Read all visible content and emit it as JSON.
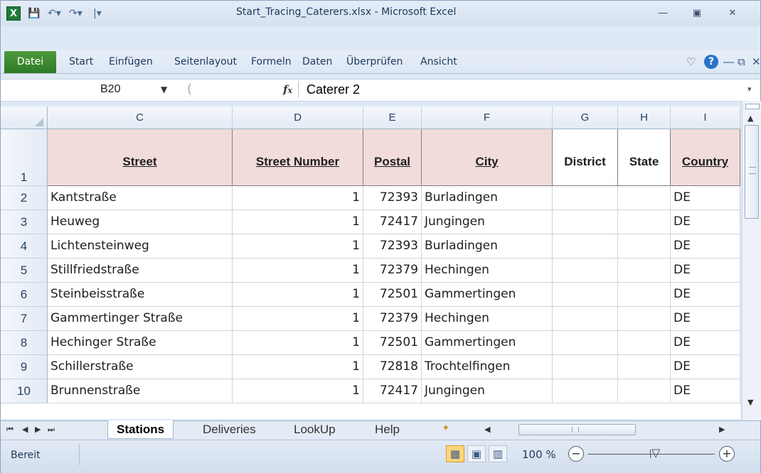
{
  "window": {
    "title": "Start_Tracing_Caterers.xlsx  -  Microsoft Excel",
    "app_icon": "excel-icon",
    "minimize_icon": "minimize-icon",
    "restore_icon": "restore-icon",
    "close_icon": "close-icon"
  },
  "qat": {
    "save_icon": "save-icon",
    "undo_icon": "undo-icon",
    "redo_icon": "redo-icon",
    "customize_icon": "customize-qat-icon"
  },
  "ribbon": {
    "file_tab": "Datei",
    "tabs": [
      "Start",
      "Einfügen",
      "Seitenlayout",
      "Formeln",
      "Daten",
      "Überprüfen",
      "Ansicht"
    ]
  },
  "formula_bar": {
    "name_box": "B20",
    "fx_label": "fx",
    "content": "Caterer 2"
  },
  "grid": {
    "columns": [
      "C",
      "D",
      "E",
      "F",
      "G",
      "H",
      "I"
    ],
    "header_row": {
      "row_number": "1",
      "cells": [
        "Street",
        "Street Number",
        "Postal",
        "City",
        "District",
        "State",
        "Country"
      ]
    },
    "rows": [
      {
        "n": "2",
        "street": "Kantstraße",
        "number": "1",
        "postal": "72393",
        "city": "Burladingen",
        "district": "",
        "state": "",
        "country": "DE"
      },
      {
        "n": "3",
        "street": "Heuweg",
        "number": "1",
        "postal": "72417",
        "city": "Jungingen",
        "district": "",
        "state": "",
        "country": "DE"
      },
      {
        "n": "4",
        "street": "Lichtensteinweg",
        "number": "1",
        "postal": "72393",
        "city": "Burladingen",
        "district": "",
        "state": "",
        "country": "DE"
      },
      {
        "n": "5",
        "street": "Stillfriedstraße",
        "number": "1",
        "postal": "72379",
        "city": "Hechingen",
        "district": "",
        "state": "",
        "country": "DE"
      },
      {
        "n": "6",
        "street": "Steinbeisstraße",
        "number": "1",
        "postal": "72501",
        "city": "Gammertingen",
        "district": "",
        "state": "",
        "country": "DE"
      },
      {
        "n": "7",
        "street": "Gammertinger Straße",
        "number": "1",
        "postal": "72379",
        "city": "Hechingen",
        "district": "",
        "state": "",
        "country": "DE"
      },
      {
        "n": "8",
        "street": "Hechinger Straße",
        "number": "1",
        "postal": "72501",
        "city": "Gammertingen",
        "district": "",
        "state": "",
        "country": "DE"
      },
      {
        "n": "9",
        "street": "Schillerstraße",
        "number": "1",
        "postal": "72818",
        "city": "Trochtelfingen",
        "district": "",
        "state": "",
        "country": "DE"
      },
      {
        "n": "10",
        "street": "Brunnenstraße",
        "number": "1",
        "postal": "72417",
        "city": "Jungingen",
        "district": "",
        "state": "",
        "country": "DE"
      }
    ]
  },
  "sheets": {
    "tabs": [
      "Stations",
      "Deliveries",
      "LookUp",
      "Help"
    ],
    "active": "Stations"
  },
  "status_bar": {
    "status": "Bereit",
    "zoom": "100 %"
  },
  "colors": {
    "header_fill": "#f2dcdb",
    "file_tab": "#2d7a26",
    "accent": "#1e395b"
  }
}
